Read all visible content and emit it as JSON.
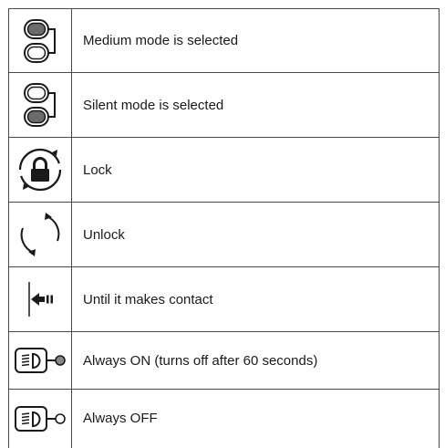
{
  "rows": [
    {
      "icon": "medium-mode-icon",
      "label": "Medium mode is selected"
    },
    {
      "icon": "silent-mode-icon",
      "label": "Silent mode is selected"
    },
    {
      "icon": "lock-icon",
      "label": "Lock"
    },
    {
      "icon": "unlock-icon",
      "label": "Unlock"
    },
    {
      "icon": "contact-arrow-icon",
      "label": "Until it makes contact"
    },
    {
      "icon": "light-always-on-icon",
      "label": "Always ON (turns off after 60 seconds)"
    },
    {
      "icon": "light-always-off-icon",
      "label": "Always OFF"
    }
  ],
  "colors": {
    "border": "#4a4a4a",
    "icon_stroke": "#1a1a1a",
    "icon_fill_dark": "#6b6b6b",
    "lamp_fill": "#888888"
  }
}
